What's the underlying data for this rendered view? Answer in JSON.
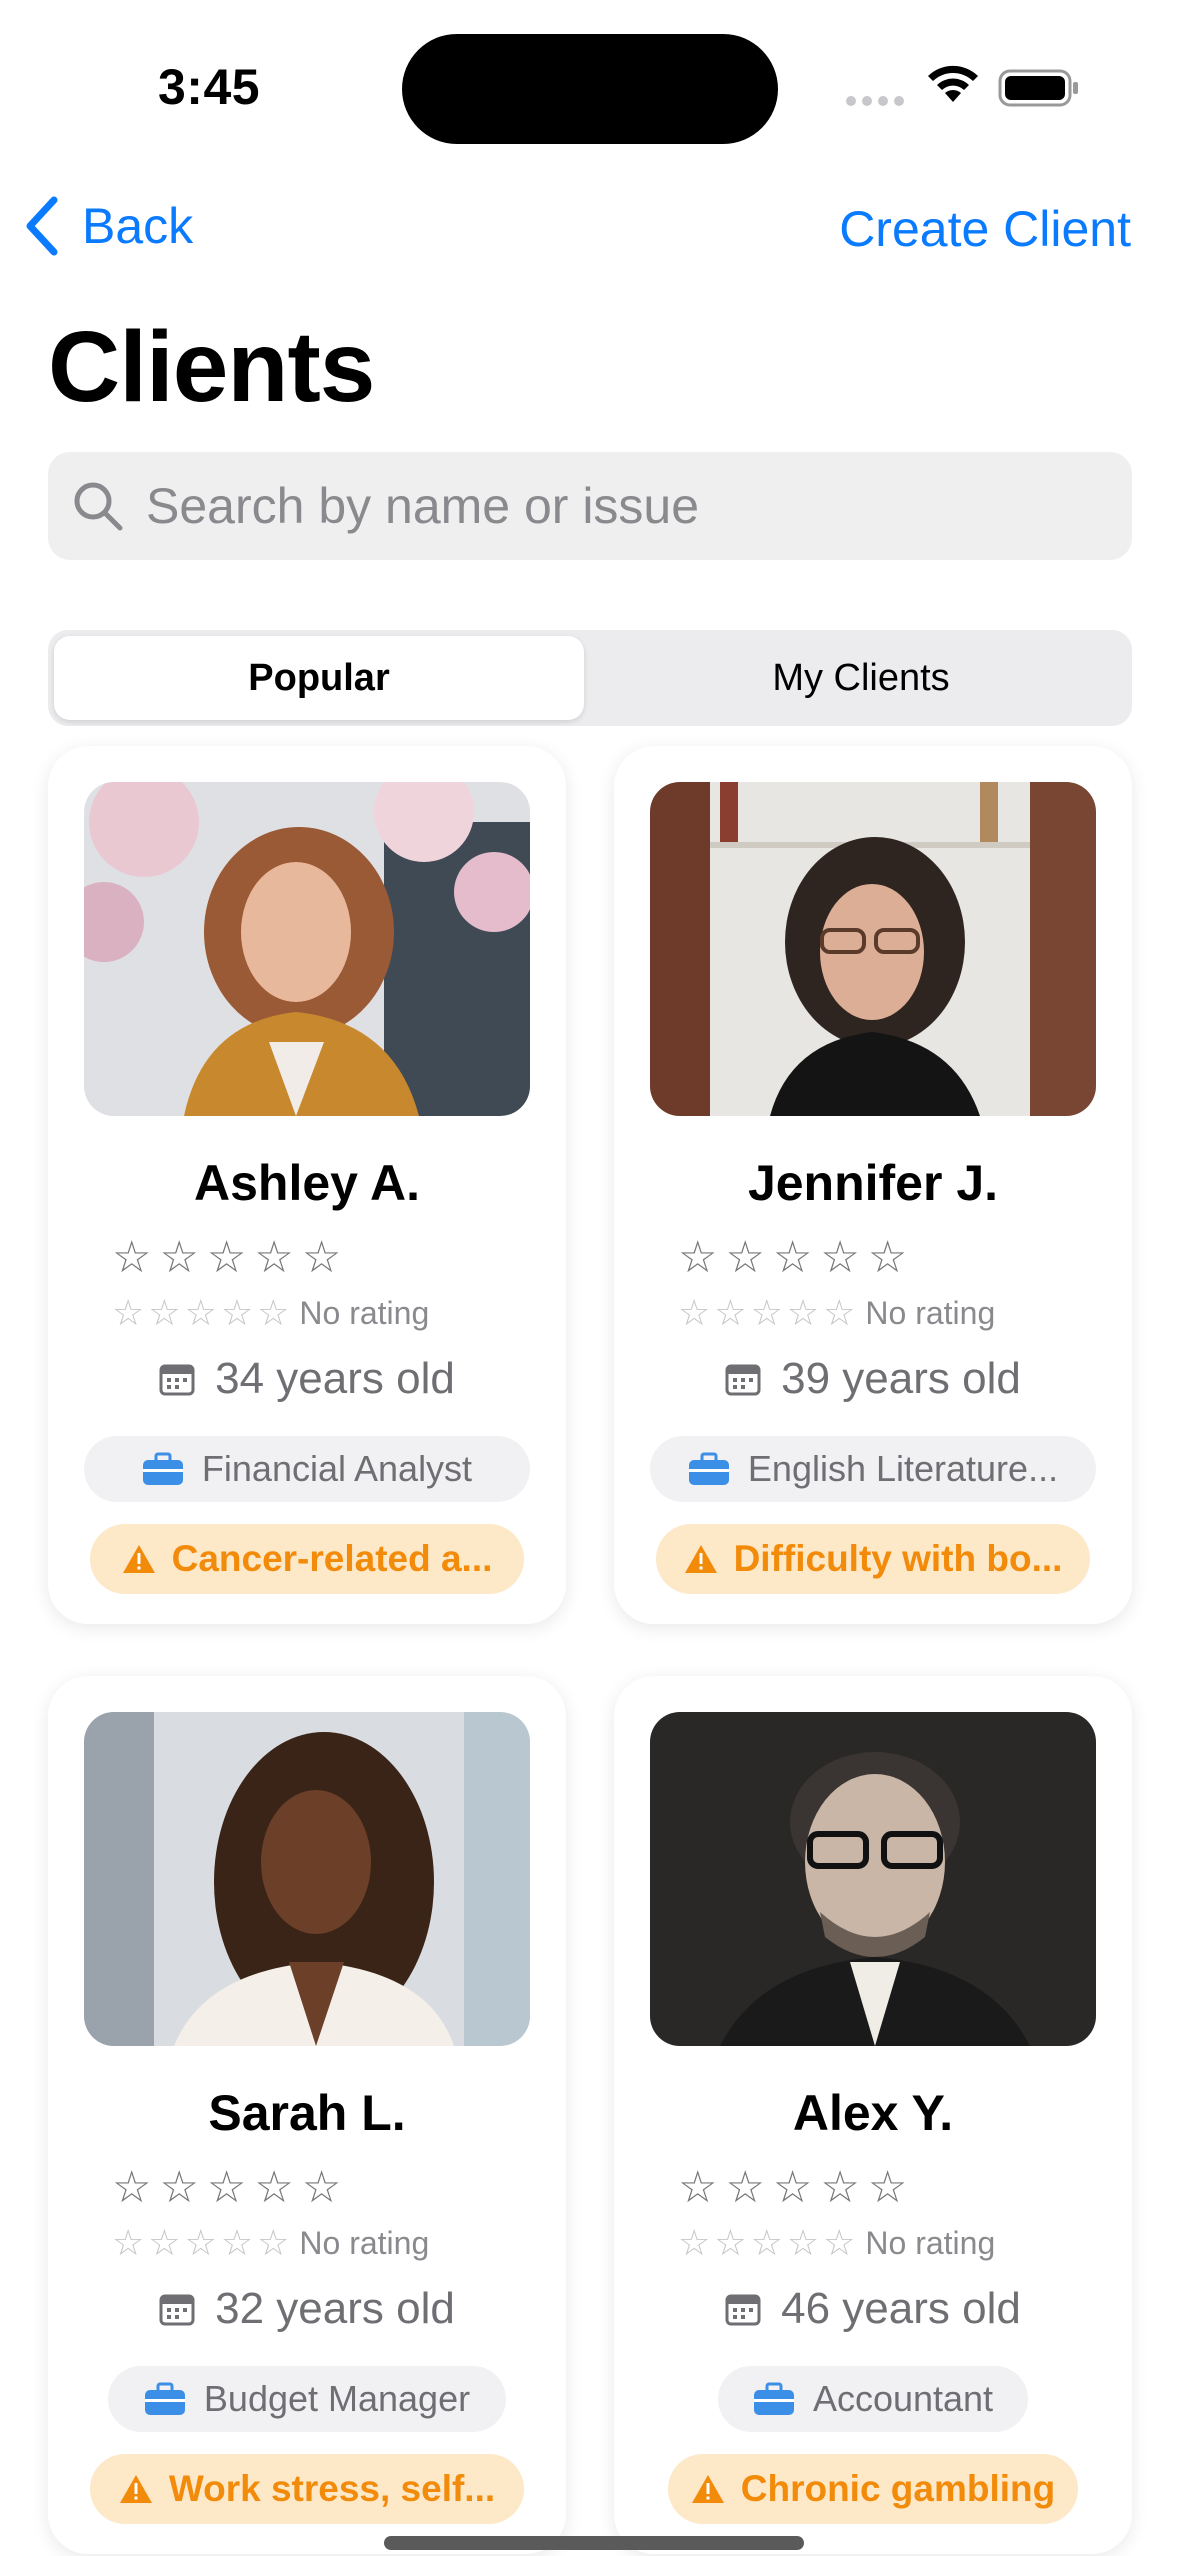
{
  "status": {
    "time": "3:45"
  },
  "nav": {
    "back_label": "Back",
    "create_label": "Create Client"
  },
  "page": {
    "title": "Clients"
  },
  "search": {
    "placeholder": "Search by name or issue"
  },
  "segments": [
    {
      "label": "Popular",
      "selected": true
    },
    {
      "label": "My Clients",
      "selected": false
    }
  ],
  "clients": [
    {
      "name": "Ashley A.",
      "age": "34 years old",
      "occupation": "Financial Analyst",
      "issue": "Cancer-related a...",
      "rating": "No rating"
    },
    {
      "name": "Jennifer J.",
      "age": "39 years old",
      "occupation": "English Literature...",
      "issue": "Difficulty with bo...",
      "rating": "No rating"
    },
    {
      "name": "Sarah L.",
      "age": "32 years old",
      "occupation": "Budget Manager",
      "issue": "Work stress, self...",
      "rating": "No rating"
    },
    {
      "name": "Alex Y.",
      "age": "46 years old",
      "occupation": "Accountant",
      "issue": "Chronic gambling",
      "rating": "No rating"
    }
  ],
  "colors": {
    "accent": "#0a7aff",
    "issue_text": "#f28a0a",
    "issue_bg": "#fde8c8",
    "job_icon": "#3b8fe6"
  }
}
